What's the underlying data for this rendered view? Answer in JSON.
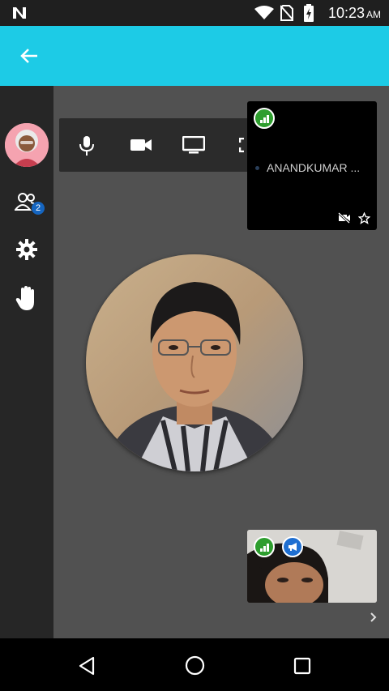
{
  "status_bar": {
    "time": "10:23",
    "ampm": "AM"
  },
  "sidebar": {
    "participants_count": "2"
  },
  "participant_tile": {
    "name": "ANANDKUMAR ..."
  },
  "icons": {
    "back": "arrow-left-icon",
    "mic": "microphone-icon",
    "camera": "video-camera-icon",
    "screen": "monitor-icon",
    "fullscreen": "fullscreen-icon",
    "participants": "people-icon",
    "settings": "gear-icon",
    "raise_hand": "hand-icon",
    "video_off": "video-off-icon",
    "star": "star-icon",
    "signal": "signal-icon",
    "speaker": "megaphone-icon",
    "next": "chevron-right-icon"
  }
}
